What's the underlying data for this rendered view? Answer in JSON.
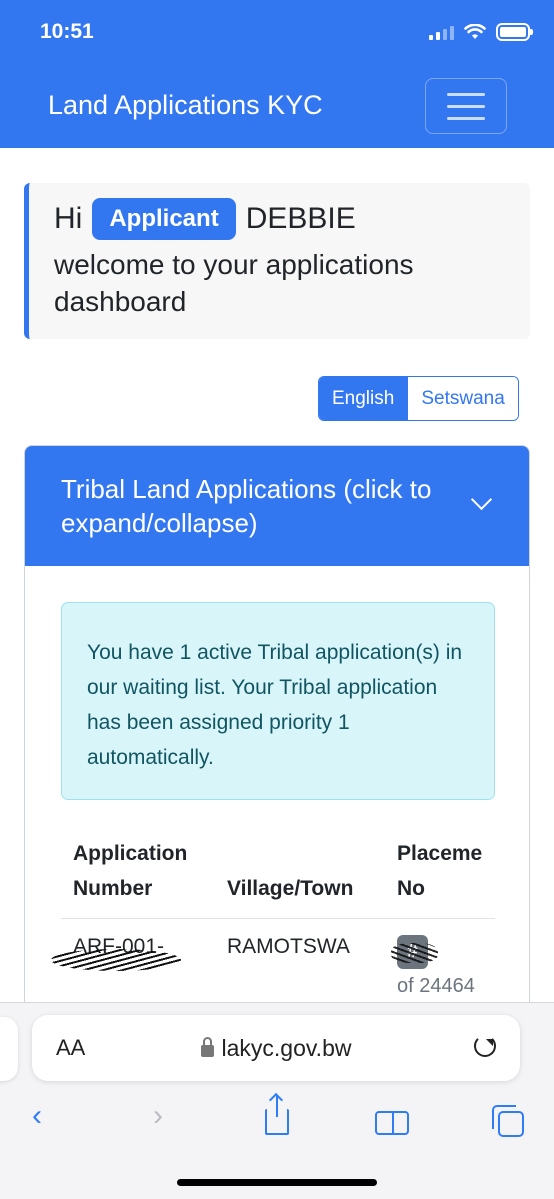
{
  "status": {
    "time": "10:51"
  },
  "navbar": {
    "brand": "Land Applications KYC"
  },
  "welcome": {
    "hi": "Hi",
    "badge": "Applicant",
    "name": "DEBBIE",
    "message": "welcome to your applications dashboard"
  },
  "language": {
    "english": "English",
    "setswana": "Setswana",
    "active": "English"
  },
  "card": {
    "header": "Tribal Land Applications (click to expand/collapse)",
    "alert": "You have 1 active Tribal application(s) in our waiting list. Your Tribal application has been assigned priority 1 automatically.",
    "table": {
      "headers": [
        "Application Number",
        "Village/Town",
        "Placeme No"
      ],
      "rows": [
        {
          "application_number": "ARF-001-",
          "village": "RAMOTSWA",
          "placement_badge": "#",
          "placement_of": "of 24464"
        }
      ]
    }
  },
  "browser": {
    "aa": "AA",
    "url": "lakyc.gov.bw"
  },
  "colors": {
    "primary": "#3377f0",
    "alert_bg": "#d8f5fa",
    "alert_text": "#115561",
    "secondary": "#6c757d"
  }
}
